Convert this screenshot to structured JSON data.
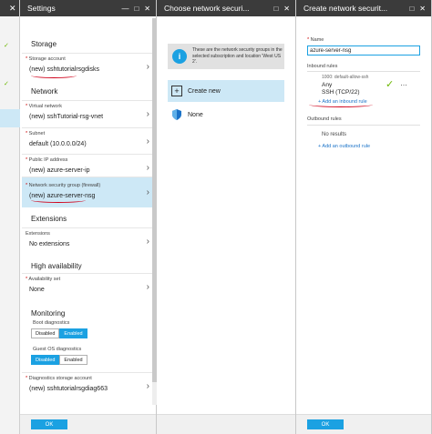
{
  "stub": {
    "close": "✕"
  },
  "settings": {
    "title": "Settings",
    "controls": [
      "—",
      "□",
      "✕"
    ],
    "storage_heading": "Storage",
    "storage_account": {
      "label": "Storage account",
      "value": "(new) sshtutorialrsgdisks"
    },
    "network_heading": "Network",
    "virtual_network": {
      "label": "Virtual network",
      "value": "(new) sshTutorial-rsg-vnet"
    },
    "subnet": {
      "label": "Subnet",
      "value": "default (10.0.0.0/24)"
    },
    "public_ip": {
      "label": "Public IP address",
      "value": "(new) azure-server-ip"
    },
    "nsg": {
      "label": "Network security group (firewall)",
      "value": "(new) azure-server-nsg"
    },
    "extensions_heading": "Extensions",
    "extensions": {
      "label": "Extensions",
      "value": "No extensions"
    },
    "ha_heading": "High availability",
    "availability_set": {
      "label": "Availability set",
      "value": "None"
    },
    "monitoring_heading": "Monitoring",
    "boot_diag": {
      "label": "Boot diagnostics",
      "options": [
        "Disabled",
        "Enabled"
      ],
      "selected": "Enabled"
    },
    "guest_diag": {
      "label": "Guest OS diagnostics",
      "options": [
        "Disabled",
        "Enabled"
      ],
      "selected": "Disabled"
    },
    "diag_storage": {
      "label": "Diagnostics storage account",
      "value": "(new) sshtutorialrsgdiag663"
    },
    "ok": "OK"
  },
  "choose": {
    "title": "Choose network securi...",
    "controls": [
      "□",
      "✕"
    ],
    "info_text": "These are the network security groups in the selected subscription and location 'West US 2'.",
    "create_new": "Create new",
    "none": "None"
  },
  "create": {
    "title": "Create network securit...",
    "controls": [
      "□",
      "✕"
    ],
    "name_label": "Name",
    "name_value": "azure-server-nsg",
    "inbound_label": "Inbound rules",
    "rule_name": "1000: default-allow-ssh",
    "rule_source": "Any",
    "rule_port": "SSH (TCP/22)",
    "add_inbound": "+ Add an inbound rule",
    "outbound_label": "Outbound rules",
    "no_results": "No results",
    "add_outbound": "+ Add an outbound rule",
    "ok": "OK"
  },
  "colors": {
    "accent": "#1ba1e2",
    "selected": "#cde8f6",
    "annotation": "#d0021b",
    "check": "#6bb700"
  }
}
